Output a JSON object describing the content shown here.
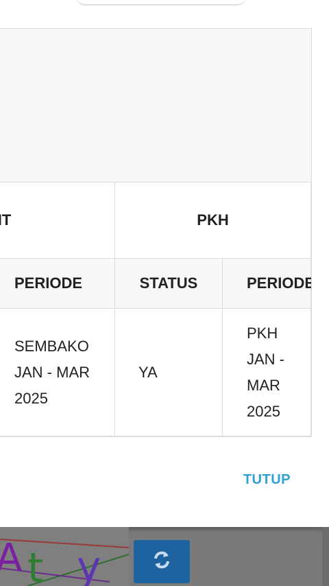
{
  "table": {
    "group_headers": [
      "NT",
      "PKH"
    ],
    "sub_headers": [
      "PERIODE",
      "STATUS",
      "PERIODE"
    ],
    "rows": [
      [
        "SEMBAKO JAN - MAR 2025",
        "YA",
        "PKH JAN - MAR 2025"
      ]
    ]
  },
  "dialog": {
    "close_label": "TUTUP"
  },
  "captcha": {
    "text": "Aty"
  },
  "icons": {
    "refresh": "refresh-icon"
  },
  "colors": {
    "accent": "#2f9fd6",
    "refresh_button": "#1f62a0"
  }
}
